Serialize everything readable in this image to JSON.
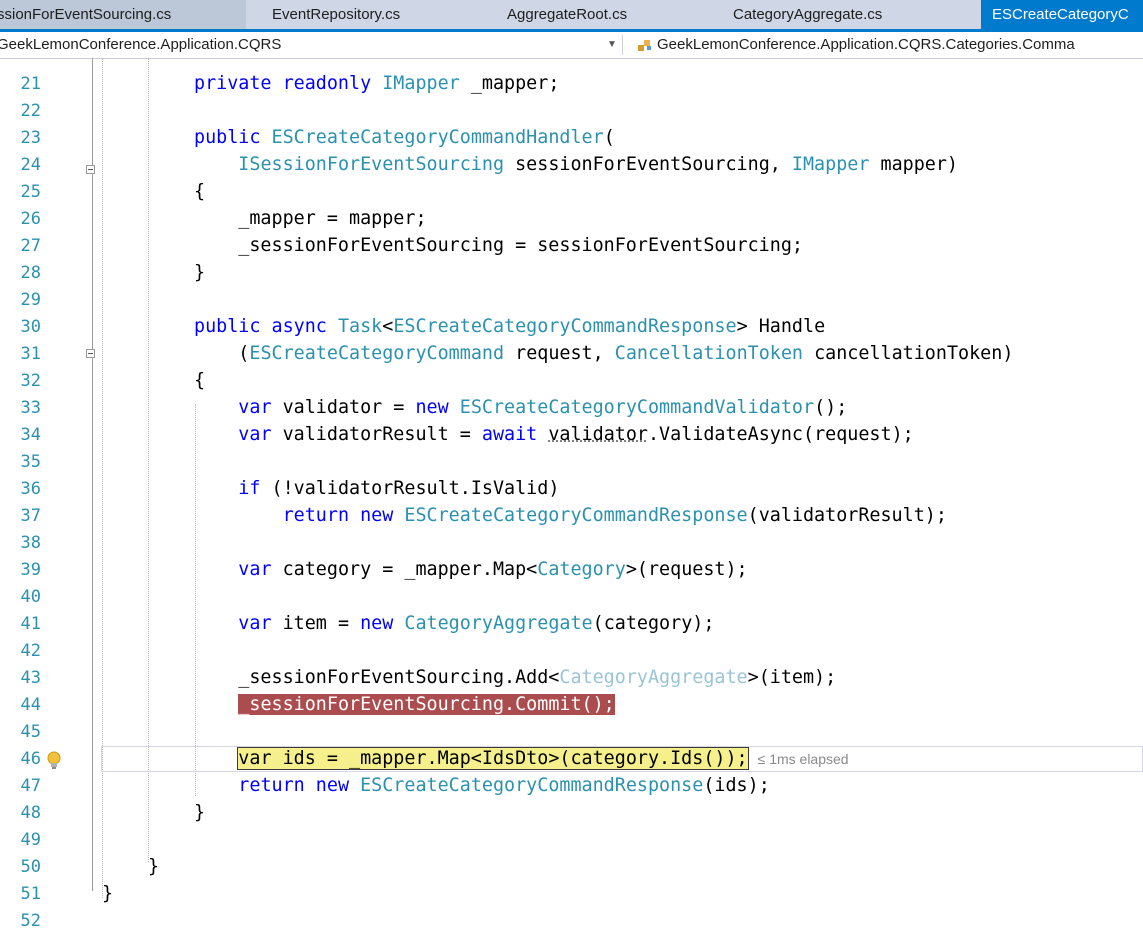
{
  "tabs": [
    {
      "label": "ssionForEventSourcing.cs"
    },
    {
      "label": "EventRepository.cs"
    },
    {
      "label": "AggregateRoot.cs"
    },
    {
      "label": "CategoryAggregate.cs"
    },
    {
      "label": "ESCreateCategoryC"
    }
  ],
  "navbar": {
    "project": "GeekLemonConference.Application.CQRS",
    "type_scope": "GeekLemonConference.Application.CQRS.Categories.Comma"
  },
  "lines": [
    {
      "n": "21",
      "segments": [
        {
          "t": "private readonly ",
          "c": "kw"
        },
        {
          "t": "IMapper",
          "c": "ty"
        },
        {
          "t": " _mapper;"
        }
      ]
    },
    {
      "n": "22",
      "segments": []
    },
    {
      "n": "23",
      "segments": [
        {
          "t": "public ",
          "c": "kw"
        },
        {
          "t": "ESCreateCategoryCommandHandler",
          "c": "ty"
        },
        {
          "t": "("
        }
      ]
    },
    {
      "n": "24",
      "segments": [
        {
          "t": "    "
        },
        {
          "t": "ISessionForEventSourcing",
          "c": "ty"
        },
        {
          "t": " sessionForEventSourcing, "
        },
        {
          "t": "IMapper",
          "c": "ty"
        },
        {
          "t": " mapper)"
        }
      ]
    },
    {
      "n": "25",
      "segments": [
        {
          "t": "{"
        }
      ]
    },
    {
      "n": "26",
      "segments": [
        {
          "t": "    _mapper = mapper;"
        }
      ]
    },
    {
      "n": "27",
      "segments": [
        {
          "t": "    _sessionForEventSourcing = sessionForEventSourcing;"
        }
      ]
    },
    {
      "n": "28",
      "segments": [
        {
          "t": "}"
        }
      ]
    },
    {
      "n": "29",
      "segments": []
    },
    {
      "n": "30",
      "segments": [
        {
          "t": "public async ",
          "c": "kw"
        },
        {
          "t": "Task",
          "c": "ty"
        },
        {
          "t": "<"
        },
        {
          "t": "ESCreateCategoryCommandResponse",
          "c": "ty"
        },
        {
          "t": "> Handle"
        }
      ]
    },
    {
      "n": "31",
      "segments": [
        {
          "t": "    ("
        },
        {
          "t": "ESCreateCategoryCommand",
          "c": "ty"
        },
        {
          "t": " request, "
        },
        {
          "t": "CancellationToken",
          "c": "ty"
        },
        {
          "t": " cancellationToken)"
        }
      ]
    },
    {
      "n": "32",
      "segments": [
        {
          "t": "{"
        }
      ]
    },
    {
      "n": "33",
      "segments": [
        {
          "t": "    "
        },
        {
          "t": "var",
          "c": "kw"
        },
        {
          "t": " validator = "
        },
        {
          "t": "new ",
          "c": "kw"
        },
        {
          "t": "ESCreateCategoryCommandValidator",
          "c": "ty"
        },
        {
          "t": "();"
        }
      ]
    },
    {
      "n": "34",
      "segments": [
        {
          "t": "    "
        },
        {
          "t": "var",
          "c": "kw"
        },
        {
          "t": " validatorResult = "
        },
        {
          "t": "await ",
          "c": "kw"
        },
        {
          "t": "validator",
          "c": "sq"
        },
        {
          "t": ".ValidateAsync(request);"
        }
      ]
    },
    {
      "n": "35",
      "segments": []
    },
    {
      "n": "36",
      "segments": [
        {
          "t": "    "
        },
        {
          "t": "if",
          "c": "kw"
        },
        {
          "t": " (!validatorResult.IsValid)"
        }
      ]
    },
    {
      "n": "37",
      "segments": [
        {
          "t": "        "
        },
        {
          "t": "return new ",
          "c": "kw"
        },
        {
          "t": "ESCreateCategoryCommandResponse",
          "c": "ty"
        },
        {
          "t": "(validatorResult);"
        }
      ]
    },
    {
      "n": "38",
      "segments": []
    },
    {
      "n": "39",
      "segments": [
        {
          "t": "    "
        },
        {
          "t": "var",
          "c": "kw"
        },
        {
          "t": " category = _mapper.Map<"
        },
        {
          "t": "Category",
          "c": "ty"
        },
        {
          "t": ">(request);"
        }
      ]
    },
    {
      "n": "40",
      "segments": []
    },
    {
      "n": "41",
      "segments": [
        {
          "t": "    "
        },
        {
          "t": "var",
          "c": "kw"
        },
        {
          "t": " item = "
        },
        {
          "t": "new ",
          "c": "kw"
        },
        {
          "t": "CategoryAggregate",
          "c": "ty"
        },
        {
          "t": "(category);"
        }
      ]
    },
    {
      "n": "42",
      "segments": []
    },
    {
      "n": "43",
      "segments": [
        {
          "t": "    _sessionForEventSourcing.Add<"
        },
        {
          "t": "CategoryAggregate",
          "c": "dim"
        },
        {
          "t": ">(item);"
        }
      ]
    },
    {
      "n": "44",
      "segments": [
        {
          "t": "    "
        },
        {
          "t": "_sessionForEventSourcing.Commit();",
          "c": "bp"
        }
      ]
    },
    {
      "n": "45",
      "segments": []
    },
    {
      "n": "46",
      "segments": [
        {
          "t": "    "
        },
        {
          "t": "var ids = _mapper.Map<IdsDto>(category.Ids());",
          "c": "hl"
        },
        {
          "t": "≤ 1ms elapsed",
          "c": "perf"
        }
      ]
    },
    {
      "n": "47",
      "segments": [
        {
          "t": "    "
        },
        {
          "t": "return new ",
          "c": "kw"
        },
        {
          "t": "ESCreateCategoryCommandResponse",
          "c": "ty"
        },
        {
          "t": "(ids);"
        }
      ]
    },
    {
      "n": "48",
      "segments": [
        {
          "t": "}"
        }
      ]
    },
    {
      "n": "49",
      "segments": []
    },
    {
      "n": "50",
      "segments": [
        {
          "t": "}"
        }
      ]
    },
    {
      "n": "51",
      "segments": [
        {
          "t": "}"
        }
      ]
    },
    {
      "n": "52",
      "segments": []
    }
  ],
  "icons": {
    "nav_scope": "class-member-icon",
    "lightbulb": "lightbulb-icon",
    "dropdown": "chevron-down-icon"
  }
}
